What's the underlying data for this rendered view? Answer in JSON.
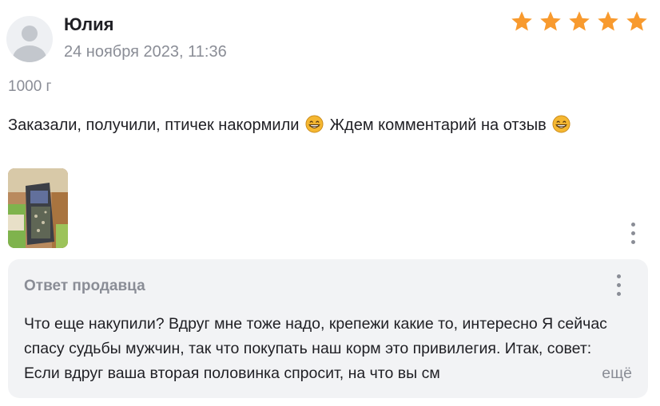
{
  "review": {
    "author": "Юлия",
    "date": "24 ноября 2023, 11:36",
    "rating": 5,
    "variant": "1000 г",
    "text_part1": "Заказали, получили, птичек накормили",
    "text_part2": "Ждем комментарий на отзыв",
    "emoji": "grinning-face"
  },
  "seller_reply": {
    "title": "Ответ продавца",
    "text": "Что еще накупили? Вдруг мне тоже надо, крепежи какие то, интересно Я сейчас спасу судьбы мужчин, так что покупать наш корм это привилегия. Итак, совет: Если вдруг ваша вторая половинка спросит, на что вы см",
    "more_label": "ещё"
  },
  "colors": {
    "star": "#f89a2e",
    "muted": "#8a8d96",
    "reply_bg": "#f2f3f5"
  }
}
